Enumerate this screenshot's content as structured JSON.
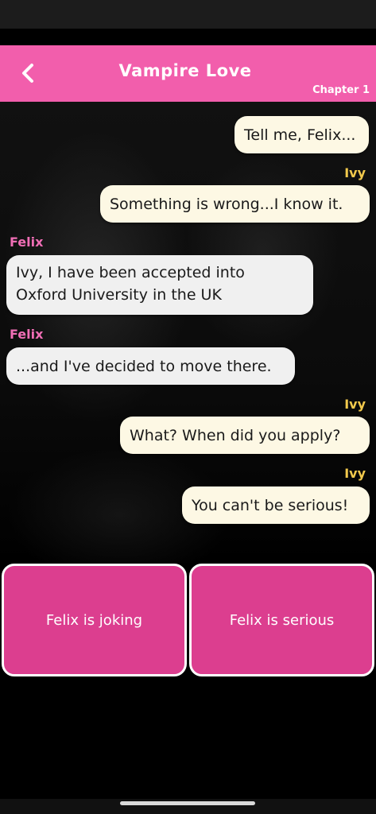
{
  "header": {
    "title": "Vampire Love",
    "chapter": "Chapter 1",
    "background_color": "#f25eac",
    "back_icon": "chevron-left-icon"
  },
  "messages": [
    {
      "speaker": "",
      "text": "Tell me, Felix..."
    },
    {
      "speaker": "Ivy",
      "text": "Something is wrong...I know it."
    },
    {
      "speaker": "Felix",
      "text": "Ivy, I have been accepted into"
    },
    {
      "speaker": "",
      "text": "Oxford University in the UK"
    },
    {
      "speaker": "Felix",
      "text": "...and I've decided to move there."
    },
    {
      "speaker": "Ivy",
      "text": "What? When did you apply?"
    },
    {
      "speaker": "Ivy",
      "text": "You can't be serious!"
    }
  ],
  "choices": [
    {
      "label": "Felix is joking"
    },
    {
      "label": "Felix is serious"
    }
  ],
  "colors": {
    "ivy_name": "#f2c94c",
    "felix_name": "#f06eb5",
    "choice_bg": "#dc3e8f",
    "ivy_bubble": "#fdf8e4",
    "felix_bubble": "#f0f0f0"
  }
}
